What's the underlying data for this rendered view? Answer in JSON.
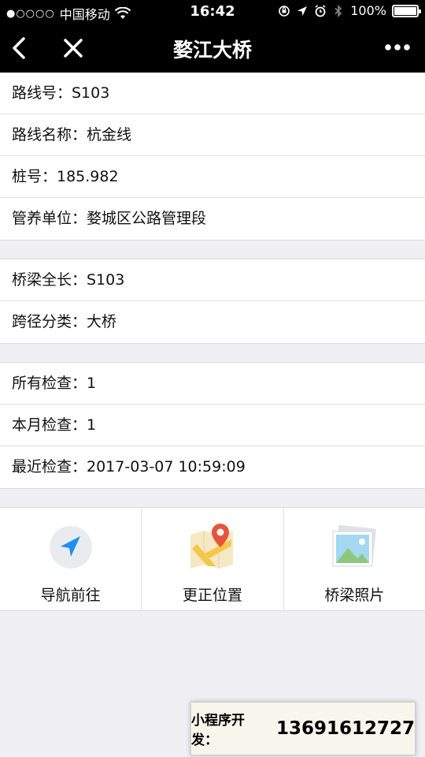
{
  "status_bar": {
    "signal": "●○○○○",
    "carrier": "中国移动",
    "time": "16:42",
    "battery": "100%"
  },
  "nav": {
    "title": "婺江大桥"
  },
  "groups": [
    {
      "rows": [
        {
          "text": "路线号：S103"
        },
        {
          "text": "路线名称：杭金线"
        },
        {
          "text": "桩号：185.982"
        },
        {
          "text": "管养单位：婺城区公路管理段"
        }
      ]
    },
    {
      "rows": [
        {
          "text": "桥梁全长：S103"
        },
        {
          "text": "跨径分类：大桥"
        }
      ]
    },
    {
      "rows": [
        {
          "text": "所有检查：1"
        },
        {
          "text": "本月检查：1"
        },
        {
          "text": "最近检查：2017-03-07 10:59:09"
        }
      ]
    }
  ],
  "actions": [
    {
      "label": "导航前往",
      "icon": "navigation-arrow-icon"
    },
    {
      "label": "更正位置",
      "icon": "map-pin-icon"
    },
    {
      "label": "桥梁照片",
      "icon": "photo-gallery-icon"
    }
  ],
  "promo": {
    "label": "小程序开发：",
    "phone": "13691612727"
  },
  "colors": {
    "background": "#efeff4",
    "nav_bar": "#000000",
    "nav_icon_blue": "#1e8ef0",
    "map_pin_red": "#e8533c",
    "map_yellow": "#f3c94a"
  }
}
